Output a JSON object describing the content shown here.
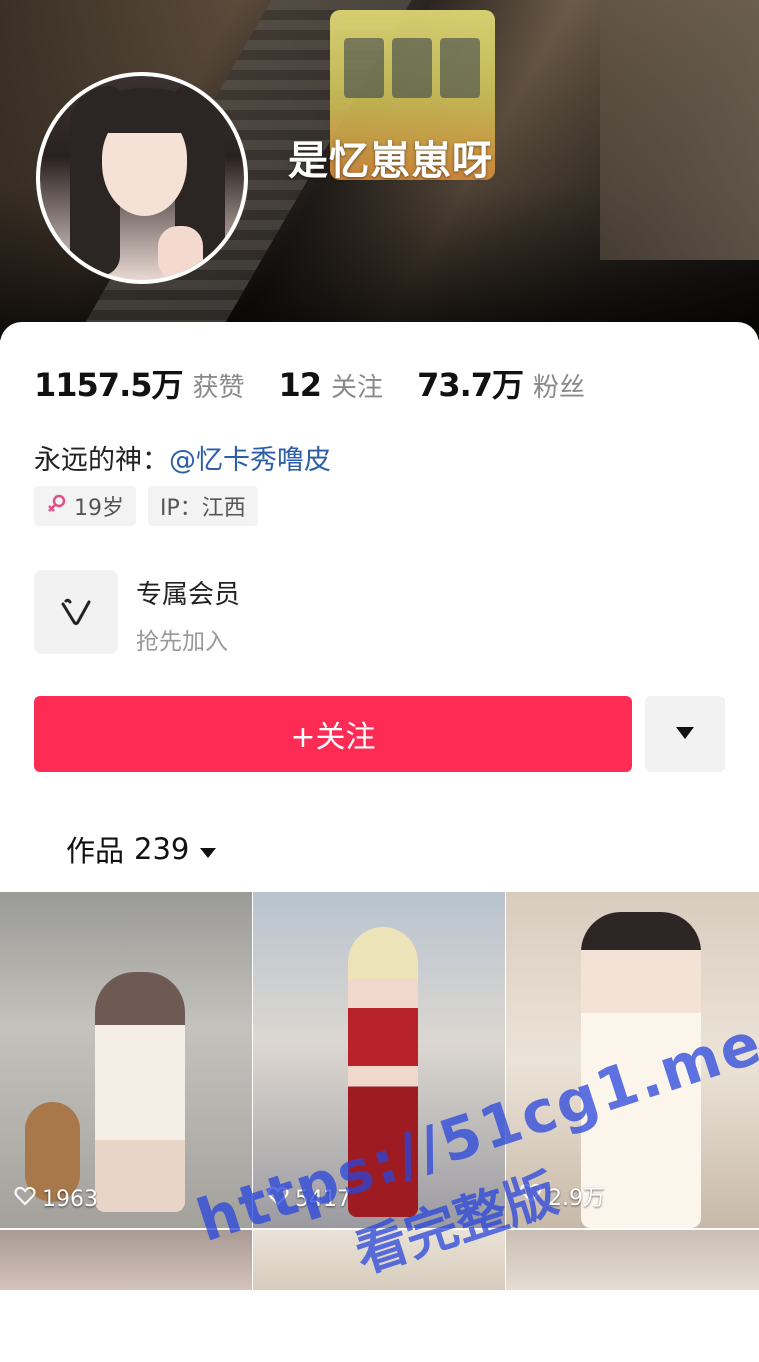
{
  "profile": {
    "username": "是忆崽崽呀",
    "stats": [
      {
        "value": "1157.5万",
        "label": "获赞"
      },
      {
        "value": "12",
        "label": "关注"
      },
      {
        "value": "73.7万",
        "label": "粉丝"
      }
    ],
    "bio_prefix": "永远的神：",
    "bio_mention": "@忆卡秀噜皮",
    "tags": {
      "age": "19岁",
      "ip": "IP：江西"
    },
    "vip_title": "专属会员",
    "vip_subtitle": "抢先加入",
    "follow_label": "+关注",
    "works_label": "作品",
    "works_count": "239"
  },
  "videos": [
    {
      "likes": "1963"
    },
    {
      "likes": "5417"
    },
    {
      "likes": "2.9万"
    }
  ],
  "watermark": {
    "url": "https://51cg1.me",
    "text": "看完整版"
  },
  "colors": {
    "accent": "#fe2c55",
    "mention": "#2d5ea8",
    "gender_icon": "#e0508a",
    "watermark": "#2846dc"
  }
}
